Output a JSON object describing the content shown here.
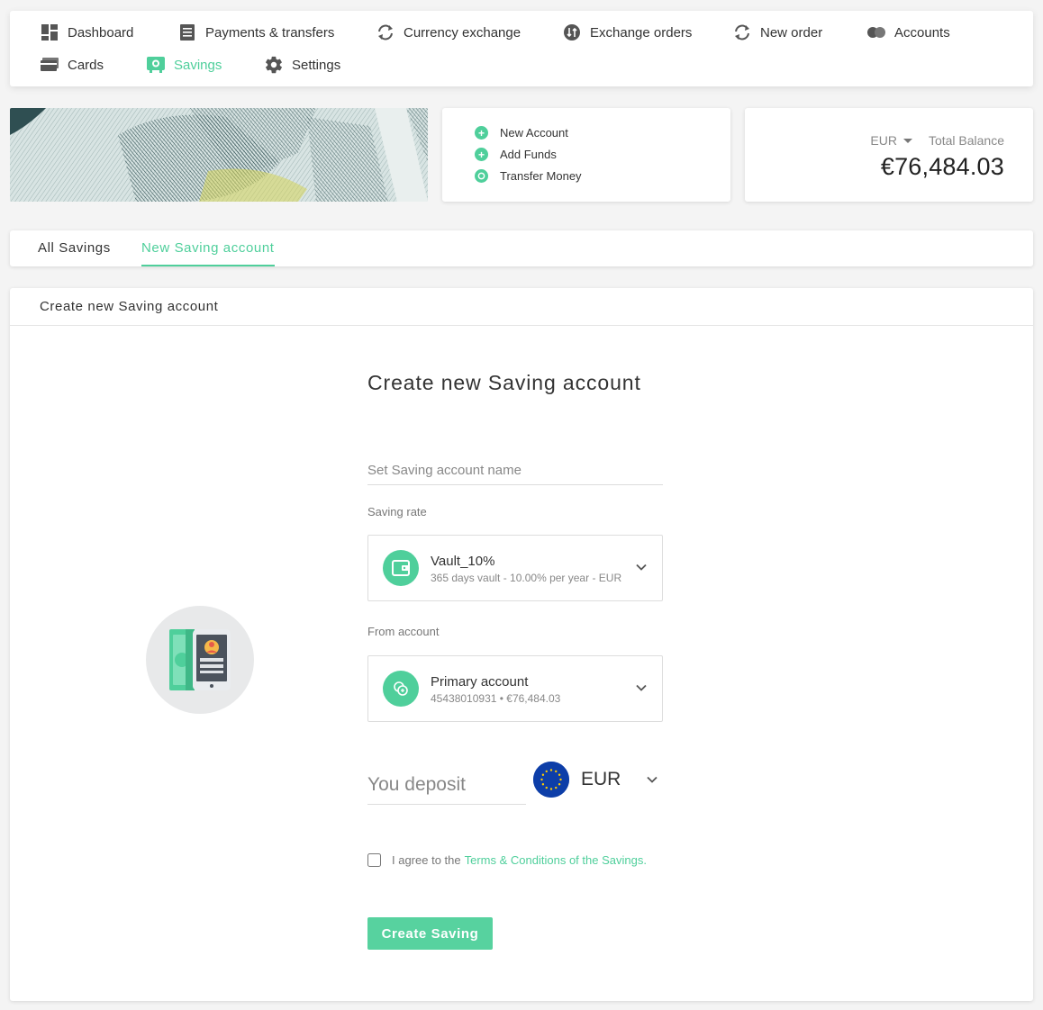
{
  "nav": {
    "items": [
      {
        "label": "Dashboard",
        "icon": "dashboard-icon"
      },
      {
        "label": "Payments & transfers",
        "icon": "list-icon"
      },
      {
        "label": "Currency exchange",
        "icon": "exchange-icon"
      },
      {
        "label": "Exchange orders",
        "icon": "exchange-orders-icon"
      },
      {
        "label": "New order",
        "icon": "refresh-icon"
      },
      {
        "label": "Accounts",
        "icon": "toggle-icon"
      },
      {
        "label": "Cards",
        "icon": "card-icon"
      },
      {
        "label": "Savings",
        "icon": "savings-icon",
        "active": true
      },
      {
        "label": "Settings",
        "icon": "gear-icon"
      }
    ]
  },
  "quick_actions": {
    "new_account": "New Account",
    "add_funds": "Add Funds",
    "transfer_money": "Transfer Money"
  },
  "balance": {
    "currency": "EUR",
    "label": "Total Balance",
    "amount": "€76,484.03"
  },
  "tabs": {
    "all_savings": "All Savings",
    "new_saving_account": "New Saving account"
  },
  "panel": {
    "header": "Create new Saving account",
    "title": "Create new Saving account",
    "name_placeholder": "Set Saving account name",
    "saving_rate_label": "Saving rate",
    "saving_rate": {
      "name": "Vault_10%",
      "detail": "365 days vault - 10.00% per year - EUR"
    },
    "from_account_label": "From account",
    "from_account": {
      "name": "Primary account",
      "detail": "45438010931 • €76,484.03"
    },
    "deposit_placeholder": "You deposit",
    "deposit_currency": "EUR",
    "agree_text": "I agree to the",
    "agree_link": "Terms & Conditions of the Savings.",
    "submit": "Create Saving"
  },
  "colors": {
    "accent": "#4fcf9b",
    "flag_blue": "#0d3ea8",
    "flag_stars": "#ffcc00"
  }
}
